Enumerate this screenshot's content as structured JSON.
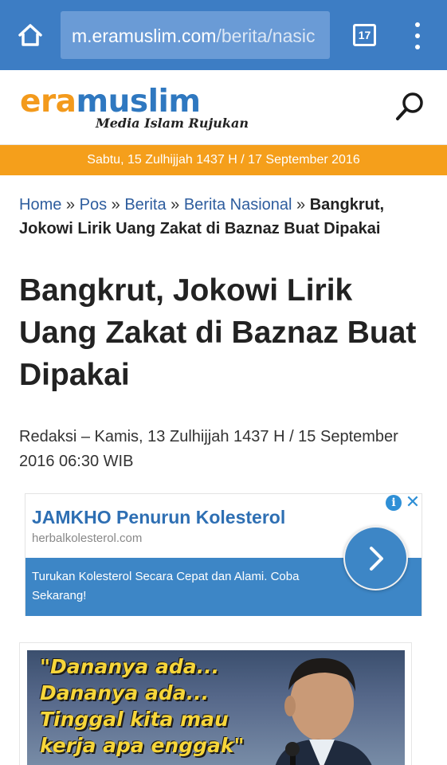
{
  "browser": {
    "url_host": "m.eramuslim.com",
    "url_path": "/berita/nasic",
    "tab_count": "17",
    "icons": {
      "home": "home-icon",
      "menu": "more-vert-icon"
    }
  },
  "site": {
    "logo_era": "era",
    "logo_muslim": "muslim",
    "tagline": "Media Islam Rujukan",
    "accent_color": "#f59f1b",
    "brand_blue": "#2f78c0"
  },
  "date_bar": "Sabtu, 15 Zulhijjah 1437 H / 17 September 2016",
  "breadcrumb": {
    "items": [
      "Home",
      "Pos",
      "Berita",
      "Berita Nasional"
    ],
    "separator": "»",
    "current": "Bangkrut, Jokowi Lirik Uang Zakat di Baznaz Buat Dipakai"
  },
  "article": {
    "title": "Bangkrut, Jokowi Lirik Uang Zakat di Baznaz Buat Dipakai",
    "byline": "Redaksi – Kamis, 13 Zulhijjah 1437 H / 15 September 2016 06:30 WIB"
  },
  "ad": {
    "headline": "JAMKHO Penurun Kolesterol",
    "domain": "herbalkolesterol.com",
    "body": "Turukan Kolesterol Secara Cepat dan Alami. Coba Sekarang!",
    "info_label": "i",
    "close_label": "✕"
  },
  "image": {
    "quote_lines": [
      "\"Dananya ada...",
      "Dananya ada...",
      "Tinggal kita mau",
      "kerja apa enggak\""
    ]
  }
}
